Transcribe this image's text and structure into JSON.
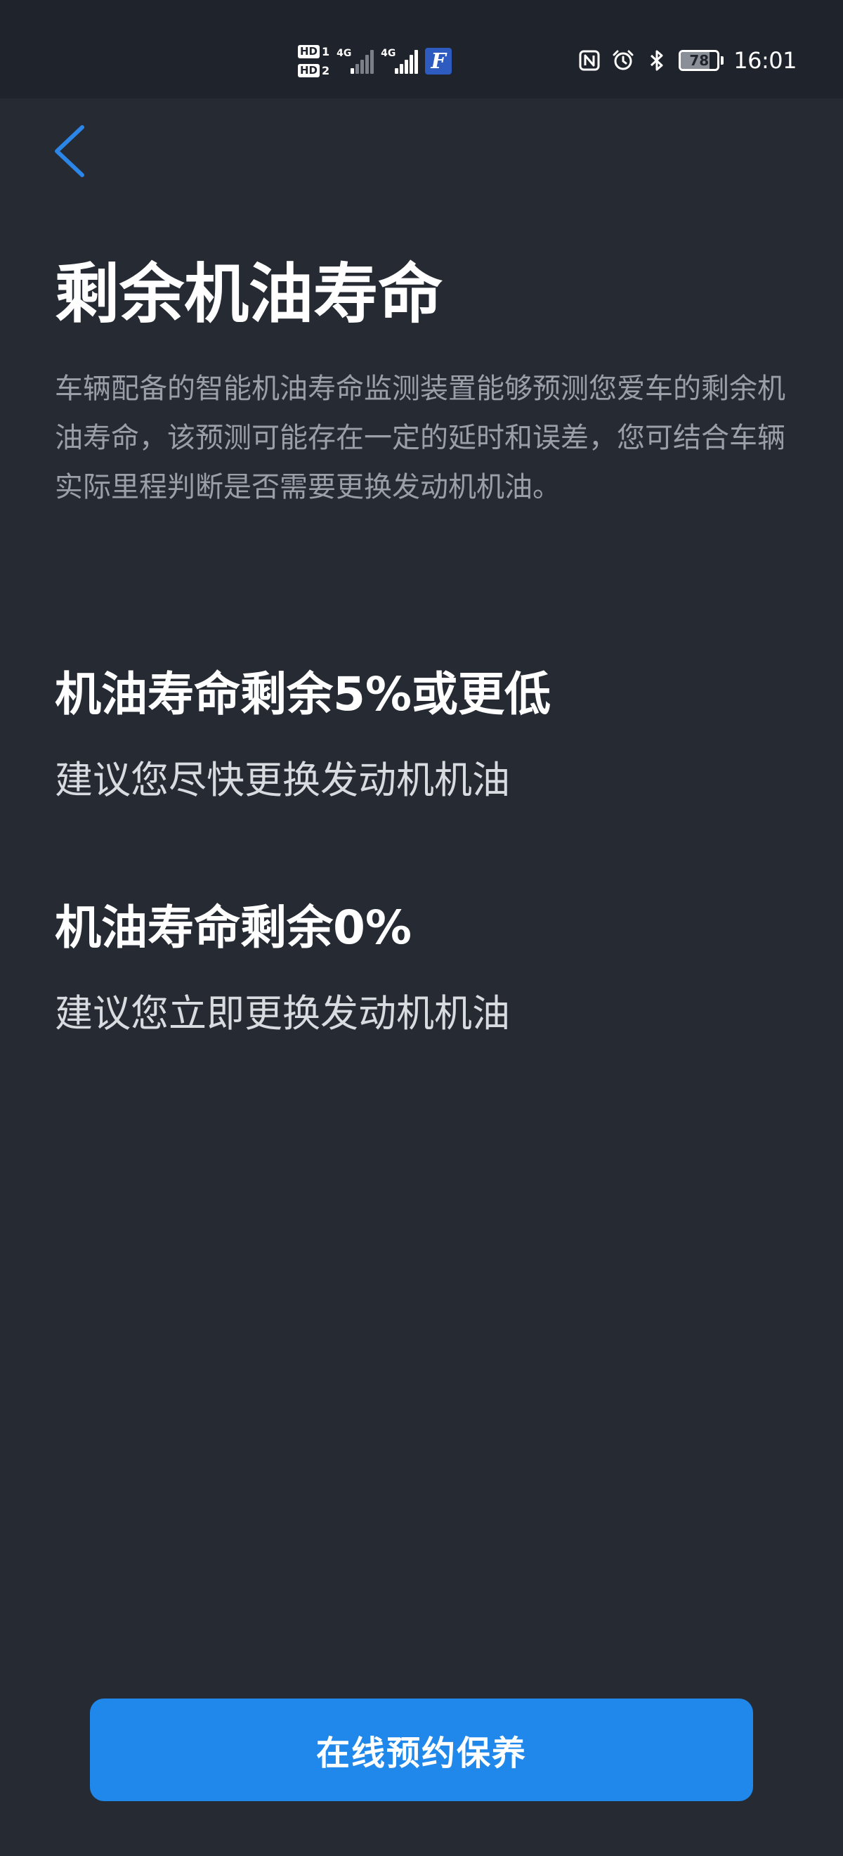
{
  "status_bar": {
    "sim1": {
      "badge": "HD",
      "slot": "1"
    },
    "sim2": {
      "badge": "HD",
      "slot": "2"
    },
    "signal1_label": "4G",
    "signal2_label": "4G",
    "app_icon": "F",
    "battery_level": "78",
    "time": "16:01",
    "icons": [
      "nfc-icon",
      "alarm-icon",
      "bluetooth-icon",
      "battery-icon"
    ]
  },
  "header": {
    "back_icon": "chevron-left-icon",
    "accent_color": "#2b86e8"
  },
  "main": {
    "title": "剩余机油寿命",
    "description": "车辆配备的智能机油寿命监测装置能够预测您爱车的剩余机油寿命，该预测可能存在一定的延时和误差，您可结合车辆实际里程判断是否需要更换发动机机油。",
    "sections": [
      {
        "heading": "机油寿命剩余5%或更低",
        "advice": "建议您尽快更换发动机机油"
      },
      {
        "heading": "机油寿命剩余0%",
        "advice": "建议您立即更换发动机机油"
      }
    ]
  },
  "footer": {
    "cta_label": "在线预约保养",
    "cta_color": "#1f88ea"
  },
  "theme": {
    "background": "#252a33",
    "status_bar_bg": "#1f232b",
    "text_primary": "#ffffff",
    "text_secondary": "#9a9fa8"
  }
}
